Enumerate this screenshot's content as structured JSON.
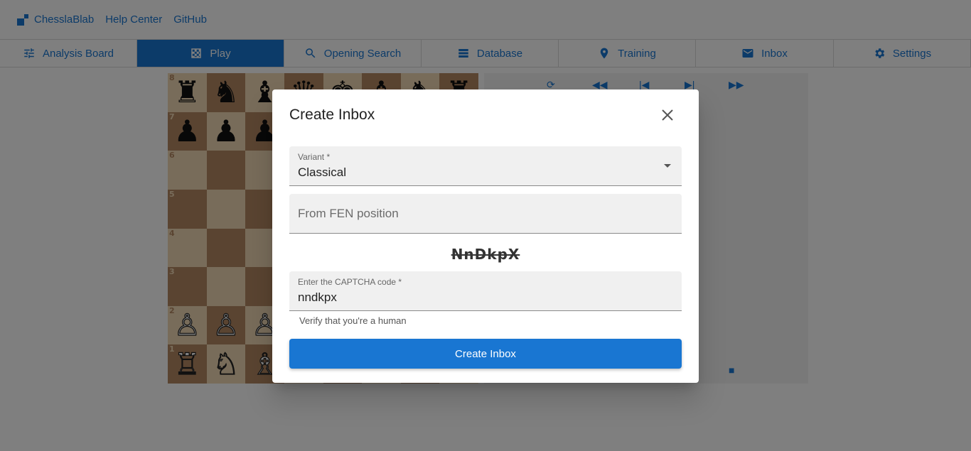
{
  "header": {
    "brand": "ChesslaBlab",
    "links": [
      "Help Center",
      "GitHub"
    ]
  },
  "tabs": [
    {
      "label": "Analysis Board",
      "icon": "sliders-icon"
    },
    {
      "label": "Play",
      "icon": "chessboard-icon",
      "active": true
    },
    {
      "label": "Opening Search",
      "icon": "search-icon"
    },
    {
      "label": "Database",
      "icon": "database-icon"
    },
    {
      "label": "Training",
      "icon": "map-pin-icon"
    },
    {
      "label": "Inbox",
      "icon": "envelope-icon"
    },
    {
      "label": "Settings",
      "icon": "gear-icon"
    }
  ],
  "board": {
    "ranks": [
      "8",
      "7",
      "6",
      "5",
      "4",
      "3",
      "2",
      "1"
    ],
    "position": [
      [
        "♜",
        "♞",
        "♝",
        "♛",
        "♚",
        "♝",
        "♞",
        "♜"
      ],
      [
        "♟",
        "♟",
        "♟",
        "♟",
        "♟",
        "♟",
        "♟",
        "♟"
      ],
      [
        "",
        "",
        "",
        "",
        "",
        "",
        "",
        ""
      ],
      [
        "",
        "",
        "",
        "",
        "",
        "",
        "",
        ""
      ],
      [
        "",
        "",
        "",
        "",
        "",
        "",
        "",
        ""
      ],
      [
        "",
        "",
        "",
        "",
        "",
        "",
        "",
        ""
      ],
      [
        "♙",
        "♙",
        "♙",
        "♙",
        "♙",
        "♙",
        "♙",
        "♙"
      ],
      [
        "♖",
        "♘",
        "♗",
        "♕",
        "♔",
        "♗",
        "♘",
        "♖"
      ]
    ]
  },
  "dialog": {
    "title": "Create Inbox",
    "variant_label": "Variant *",
    "variant_value": "Classical",
    "fen_placeholder": "From FEN position",
    "captcha_text": "NnDkpX",
    "captcha_label": "Enter the CAPTCHA code *",
    "captcha_value": "nndkpx",
    "helper": "Verify that you're a human",
    "submit_label": "Create Inbox"
  },
  "colors": {
    "accent": "#1976d2",
    "board_light": "#f0d9b5",
    "board_dark": "#b58863"
  }
}
